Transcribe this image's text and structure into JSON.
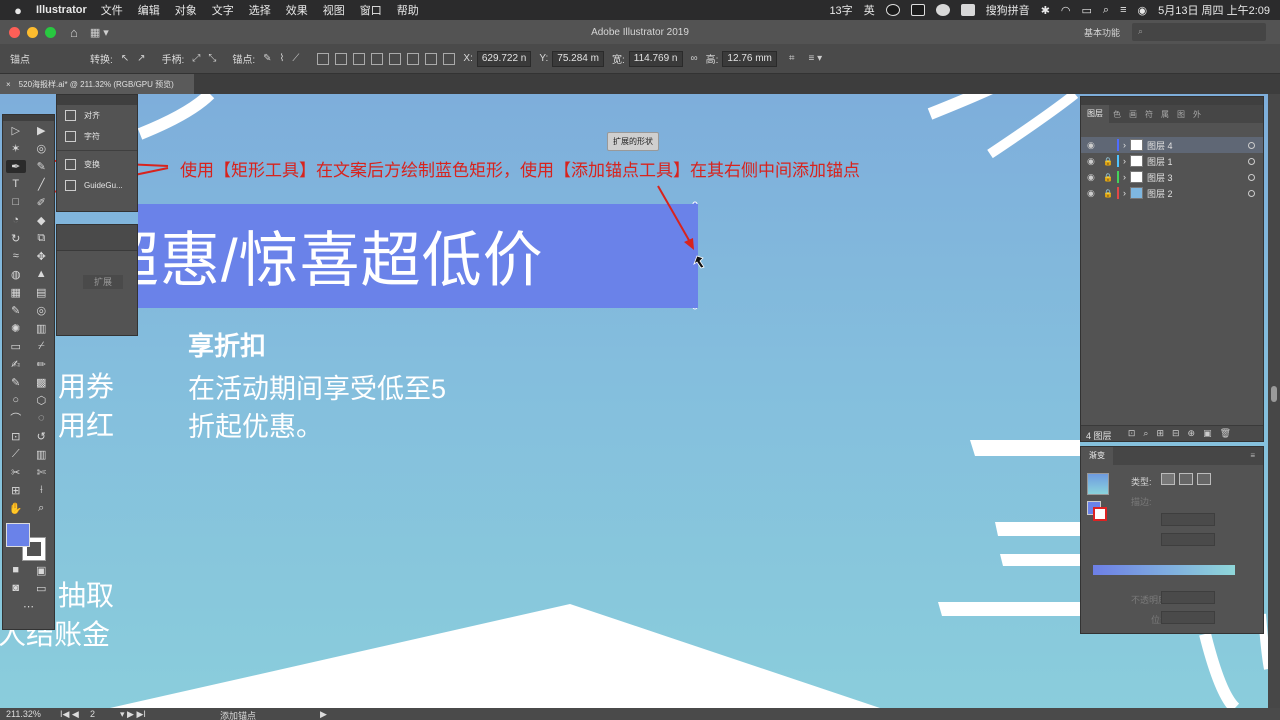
{
  "menubar": {
    "app": "Illustrator",
    "items": [
      "文件",
      "编辑",
      "对象",
      "文字",
      "选择",
      "效果",
      "视图",
      "窗口",
      "帮助"
    ],
    "word_count": "13字",
    "ime": "英",
    "input_method": "搜狗拼音",
    "datetime": "5月13日 周四 上午2:09"
  },
  "titlebar": {
    "title": "Adobe Illustrator 2019",
    "workspace": "基本功能",
    "search": ""
  },
  "control_bar": {
    "mode": "锚点",
    "convert": "转换:",
    "handles": "手柄:",
    "anchors": "锚点:",
    "x_label": "X:",
    "x_value": "629.722 n",
    "y_label": "Y:",
    "y_value": "75.284 m",
    "w_label": "宽:",
    "w_value": "114.769 n",
    "h_label": "高:",
    "h_value": "12.76 mm"
  },
  "document_tab": {
    "name": "520海报样.ai* @ 211.32% (RGB/GPU 预览)"
  },
  "canvas": {
    "headline": "惠/惊喜超低价",
    "headline_partial_char": "超",
    "body_title": "享折扣",
    "body_lines": [
      "在活动期间享受低至5",
      "折起优惠。"
    ],
    "left_text_1": [
      "用券",
      "用红"
    ],
    "left_text_2": [
      "抽取",
      "人结账金"
    ],
    "tooltip": "扩展的形状",
    "annotation": "使用【矩形工具】在文案后方绘制蓝色矩形，使用【添加锚点工具】在其右侧中间添加锚点"
  },
  "flyout": {
    "items": [
      "对齐",
      "字符",
      "变换",
      "GuideGu..."
    ]
  },
  "pathfinder": {
    "expand": "扩展"
  },
  "layers_panel": {
    "tabs": [
      "图层",
      "色",
      "画",
      "符",
      "属",
      "图",
      "外"
    ],
    "layers": [
      {
        "name": "图层 4",
        "color": "#4f6cff"
      },
      {
        "name": "图层 1",
        "color": "#4fc3ff"
      },
      {
        "name": "图层 3",
        "color": "#44d35a"
      },
      {
        "name": "图层 2",
        "color": "#e04848"
      }
    ],
    "count": "4 图层"
  },
  "gradient_panel": {
    "tab": "渐变",
    "type_label": "类型:",
    "stroke_label": "描边:",
    "opacity_label": "不透明度:",
    "position_label": "位置:"
  },
  "statusbar": {
    "zoom": "211.32%",
    "page": "2",
    "tool": "添加锚点"
  }
}
